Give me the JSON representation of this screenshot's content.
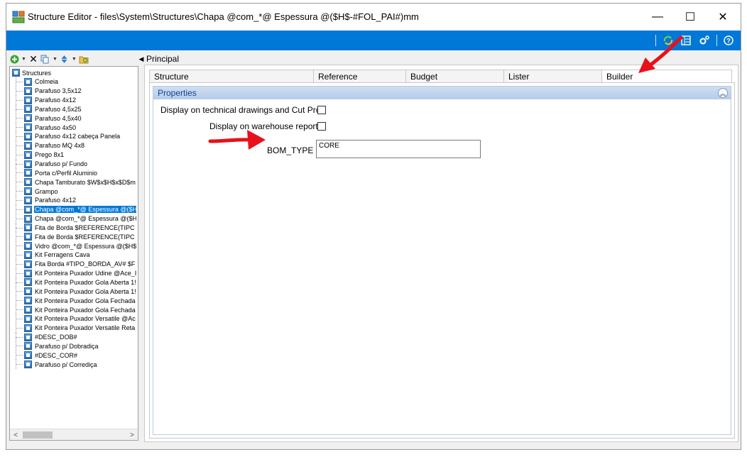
{
  "window": {
    "title": "Structure Editor - files\\System\\Structures\\Chapa @com_*@ Espessura @($H$-#FOL_PAI#)mm",
    "controls": {
      "minimize": "—",
      "maximize": "☐",
      "close": "✕"
    }
  },
  "toolbar_icons": [
    "refresh-icon",
    "layout-icon",
    "settings-icon",
    "help-icon"
  ],
  "tree": {
    "root_label": "Structures",
    "selected_index": 14,
    "items": [
      "Colmeia",
      "Parafuso 3,5x12",
      "Parafuso 4x12",
      "Parafuso 4,5x25",
      "Parafuso 4,5x40",
      "Parafuso 4x50",
      "Parafuso 4x12  cabeça Panela",
      "Parafuso MQ 4x8",
      "Prego 8x1",
      "Parafuso p/ Fundo",
      "Porta c/Perfil Aluminio",
      "Chapa Tamburato $W$x$H$x$D$m",
      "Grampo",
      "Parafuso 4x12",
      "Chapa @com_*@ Espessura @($H",
      "Chapa @com_*@ Espessura @($H",
      "Fita de Borda $REFERENCE(TIPC",
      "Fita de Borda $REFERENCE(TIPC",
      "Vidro @com_*@ Espessura @($H$",
      "Kit Ferragens Cava",
      "Fita Borda #TIPO_BORDA_AV# $F",
      "Kit Ponteira Puxador Udine @Ace_I",
      "Kit Ponteira Puxador Gola Aberta 1!",
      "Kit Ponteira Puxador Gola Aberta 1!",
      "Kit Ponteira Puxador Gola Fechada",
      "Kit Ponteira Puxador Gola Fechada",
      "Kit Ponteira Puxador Versatile @Ac",
      "Kit Ponteira Puxador Versatile Reta",
      "#DESC_DOB#",
      "Parafuso p/ Dobradiça",
      "#DESC_COR#",
      "Parafuso p/ Corrediça"
    ]
  },
  "right": {
    "section_label": "Principal",
    "tabs": [
      {
        "label": "Structure"
      },
      {
        "label": "Reference"
      },
      {
        "label": "Budget"
      },
      {
        "label": "Lister"
      },
      {
        "label": "Builder"
      }
    ],
    "active_tab": "Builder",
    "properties": {
      "header": "Properties",
      "display_drawings_label": "Display on technical drawings and Cut Pro",
      "display_drawings_checked": false,
      "display_warehouse_label": "Display on warehouse report",
      "display_warehouse_checked": false,
      "bom_type_label": "BOM_TYPE",
      "bom_type_value": "CORE"
    }
  },
  "colors": {
    "accent": "#0078d7",
    "annotation": "#e8101a"
  }
}
